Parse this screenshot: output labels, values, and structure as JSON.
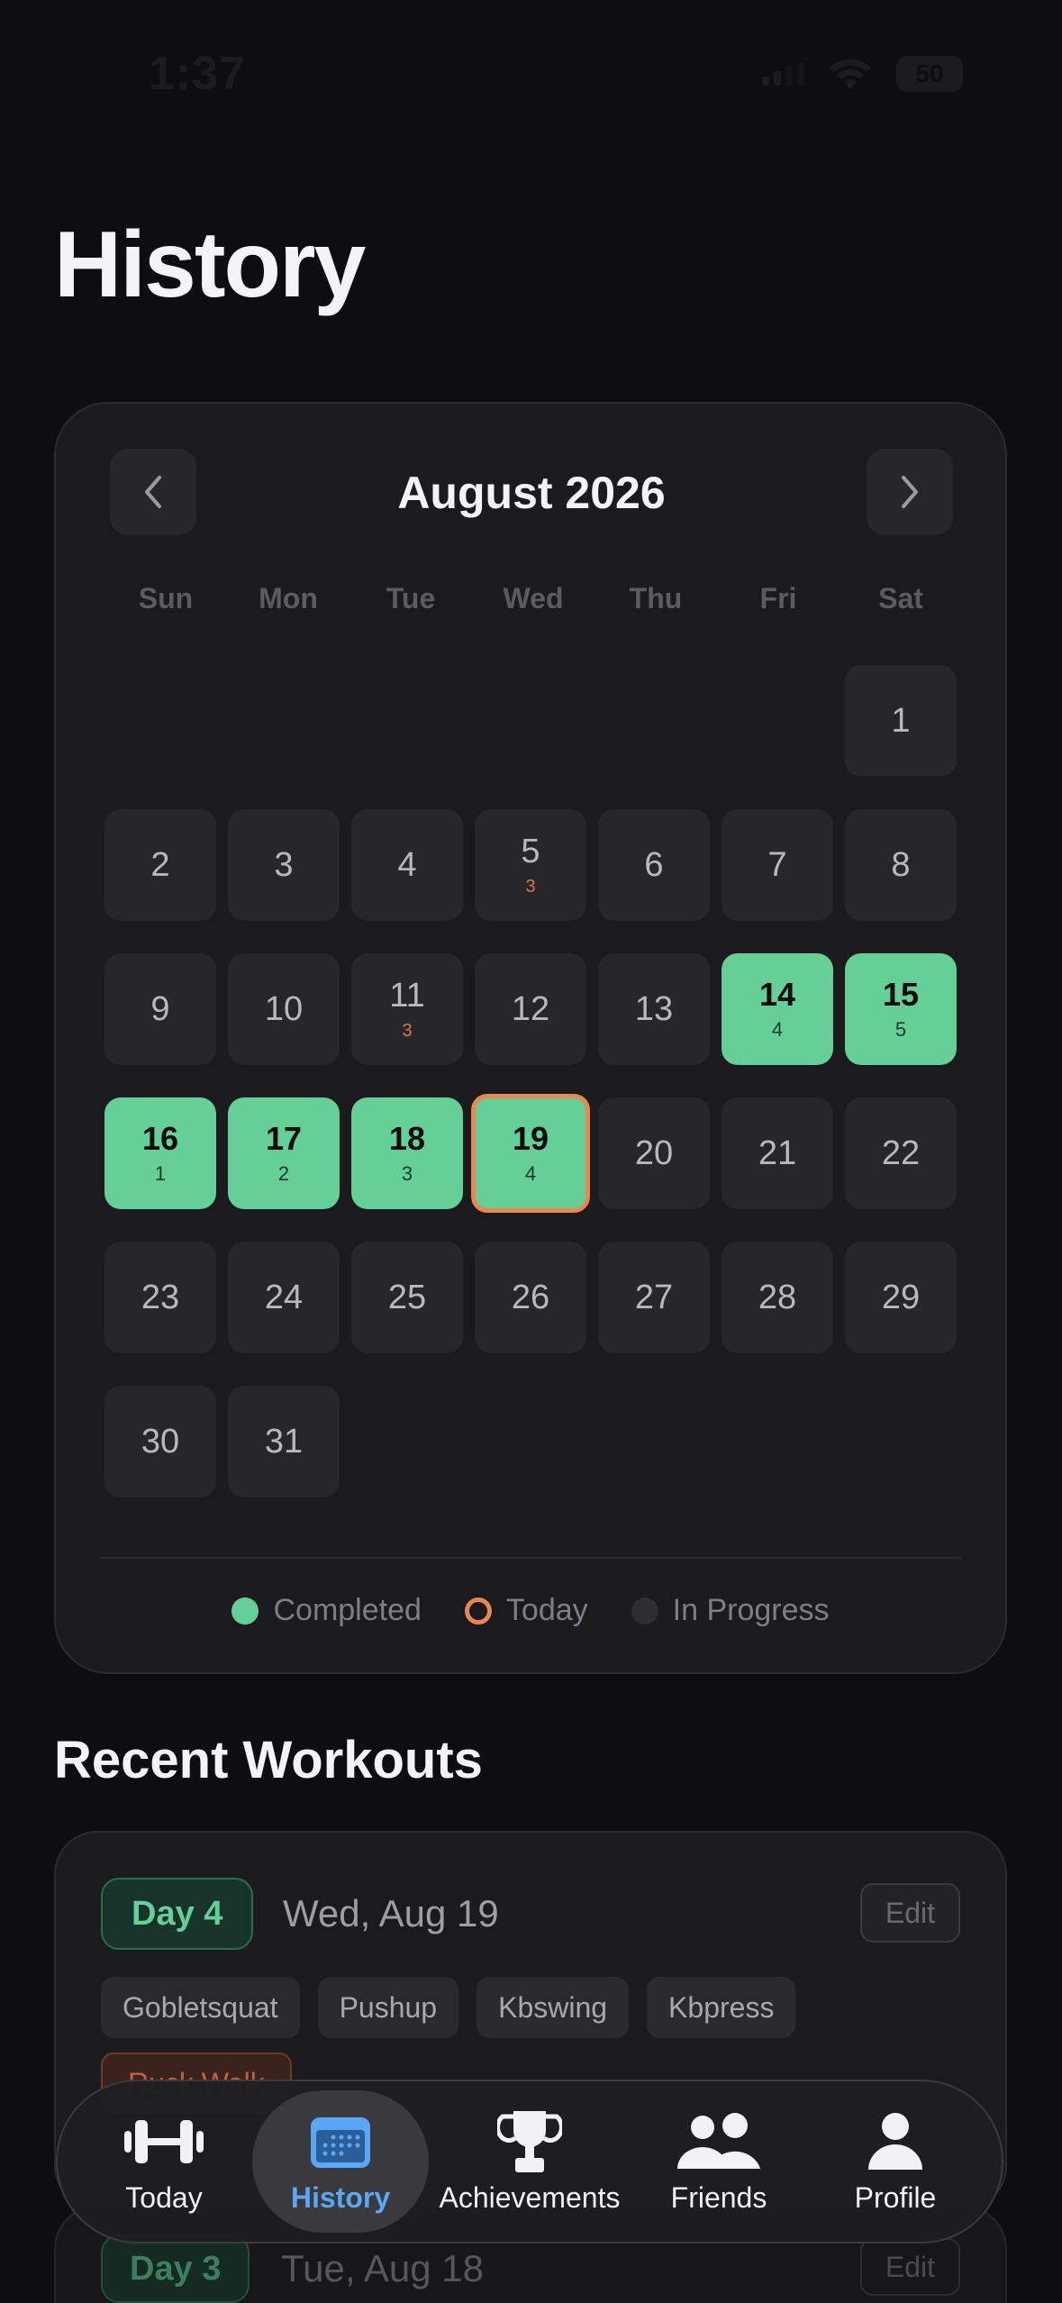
{
  "status_bar": {
    "time": "1:37",
    "battery": "50"
  },
  "page_title": "History",
  "calendar": {
    "month_label": "August 2026",
    "weekdays": [
      "Sun",
      "Mon",
      "Tue",
      "Wed",
      "Thu",
      "Fri",
      "Sat"
    ],
    "weeks": [
      [
        null,
        null,
        null,
        null,
        null,
        null,
        {
          "day": "1"
        }
      ],
      [
        {
          "day": "2"
        },
        {
          "day": "3"
        },
        {
          "day": "4"
        },
        {
          "day": "5",
          "count": "3"
        },
        {
          "day": "6"
        },
        {
          "day": "7"
        },
        {
          "day": "8"
        }
      ],
      [
        {
          "day": "9"
        },
        {
          "day": "10"
        },
        {
          "day": "11",
          "count": "3"
        },
        {
          "day": "12"
        },
        {
          "day": "13"
        },
        {
          "day": "14",
          "count": "4",
          "status": "completed"
        },
        {
          "day": "15",
          "count": "5",
          "status": "completed"
        }
      ],
      [
        {
          "day": "16",
          "count": "1",
          "status": "completed"
        },
        {
          "day": "17",
          "count": "2",
          "status": "completed"
        },
        {
          "day": "18",
          "count": "3",
          "status": "completed"
        },
        {
          "day": "19",
          "count": "4",
          "status": "completed",
          "today": true
        },
        {
          "day": "20"
        },
        {
          "day": "21"
        },
        {
          "day": "22"
        }
      ],
      [
        {
          "day": "23"
        },
        {
          "day": "24"
        },
        {
          "day": "25"
        },
        {
          "day": "26"
        },
        {
          "day": "27"
        },
        {
          "day": "28"
        },
        {
          "day": "29"
        }
      ],
      [
        {
          "day": "30"
        },
        {
          "day": "31"
        },
        null,
        null,
        null,
        null,
        null
      ]
    ],
    "legend": {
      "completed": "Completed",
      "today": "Today",
      "in_progress": "In Progress"
    }
  },
  "colors": {
    "completed": "#66cf98",
    "today": "#e88654",
    "in_progress": "#2e2e32",
    "active_tab": "#5aa8f5"
  },
  "recent_section_title": "Recent Workouts",
  "workouts": [
    {
      "badge": "Day 4",
      "date": "Wed, Aug 19",
      "edit_label": "Edit",
      "exercises": [
        "Gobletsquat",
        "Pushup",
        "Kbswing",
        "Kbpress"
      ],
      "partial_tag": "Ruck Walk"
    },
    {
      "badge": "Day 3",
      "date": "Tue, Aug 18",
      "edit_label": "Edit"
    }
  ],
  "tab_bar": {
    "tabs": [
      {
        "label": "Today",
        "icon": "dumbbell-icon"
      },
      {
        "label": "History",
        "icon": "calendar-icon",
        "active": true
      },
      {
        "label": "Achievements",
        "icon": "trophy-icon"
      },
      {
        "label": "Friends",
        "icon": "friends-icon"
      },
      {
        "label": "Profile",
        "icon": "profile-icon"
      }
    ]
  }
}
